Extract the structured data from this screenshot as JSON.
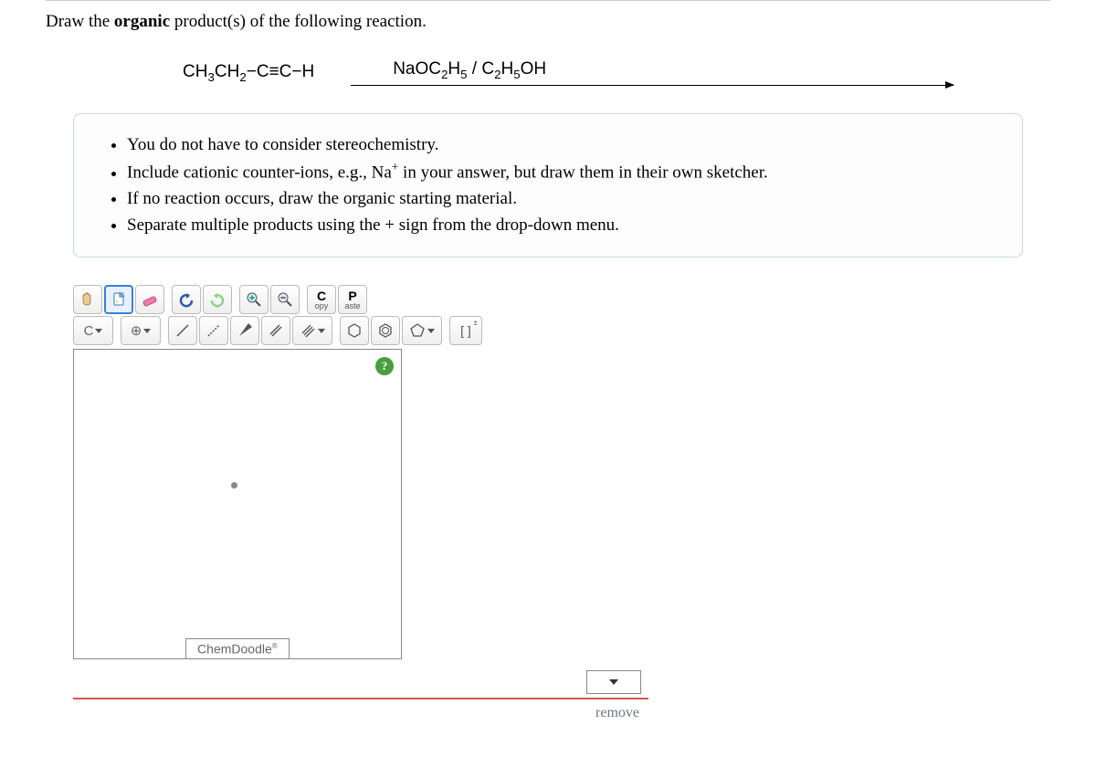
{
  "question": {
    "prompt_prefix": "Draw the ",
    "prompt_emph": "organic",
    "prompt_suffix": " product(s) of the following reaction."
  },
  "reaction": {
    "reactant_parts": [
      "CH",
      "3",
      "CH",
      "2",
      "−C≡C−H"
    ],
    "reagent_parts": [
      "NaOC",
      "2",
      "H",
      "5",
      " / C",
      "2",
      "H",
      "5",
      "OH"
    ]
  },
  "instructions": [
    "You do not have to consider stereochemistry.",
    "Include cationic counter-ions, e.g., Na in your answer, but draw them in their own sketcher.",
    "If no reaction occurs, draw the organic starting material.",
    "Separate multiple products using the + sign from the drop-down menu."
  ],
  "na_sup": "+",
  "toolbar": {
    "copy": "C",
    "copy_sub": "opy",
    "paste": "P",
    "paste_sub": "aste",
    "element": "C",
    "bracket": "[ ]",
    "bracket_charges": "±"
  },
  "labels": {
    "chemdoodle": "ChemDoodle",
    "reg": "®",
    "remove": "remove",
    "help": "?"
  }
}
